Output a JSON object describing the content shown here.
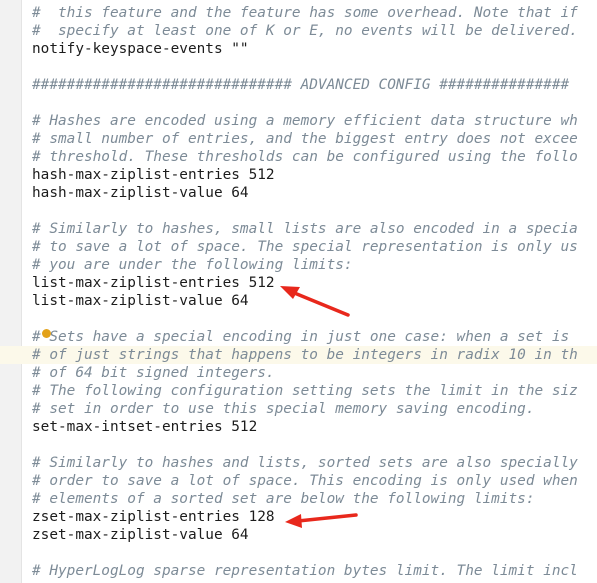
{
  "editor": {
    "lines": [
      {
        "text": "#  this feature and the feature has some overhead. Note that if",
        "kind": "comment"
      },
      {
        "text": "#  specify at least one of K or E, no events will be delivered.",
        "kind": "comment"
      },
      {
        "text": "notify-keyspace-events \"\"",
        "kind": "code"
      },
      {
        "text": "",
        "kind": "blank"
      },
      {
        "text": "############################## ADVANCED CONFIG ###############",
        "kind": "comment"
      },
      {
        "text": "",
        "kind": "blank"
      },
      {
        "text": "# Hashes are encoded using a memory efficient data structure wh",
        "kind": "comment"
      },
      {
        "text": "# small number of entries, and the biggest entry does not excee",
        "kind": "comment"
      },
      {
        "text": "# threshold. These thresholds can be configured using the follo",
        "kind": "comment"
      },
      {
        "text": "hash-max-ziplist-entries 512",
        "kind": "code"
      },
      {
        "text": "hash-max-ziplist-value 64",
        "kind": "code"
      },
      {
        "text": "",
        "kind": "blank"
      },
      {
        "text": "# Similarly to hashes, small lists are also encoded in a specia",
        "kind": "comment"
      },
      {
        "text": "# to save a lot of space. The special representation is only us",
        "kind": "comment"
      },
      {
        "text": "# you are under the following limits:",
        "kind": "comment"
      },
      {
        "text": "list-max-ziplist-entries 512",
        "kind": "code"
      },
      {
        "text": "list-max-ziplist-value 64",
        "kind": "code"
      },
      {
        "text": "",
        "kind": "blank"
      },
      {
        "text": "# Sets have a special encoding in just one case: when a set is",
        "kind": "comment"
      },
      {
        "text": "# of just strings that happens to be integers in radix 10 in th",
        "kind": "comment",
        "highlight": true
      },
      {
        "text": "# of 64 bit signed integers.",
        "kind": "comment"
      },
      {
        "text": "# The following configuration setting sets the limit in the siz",
        "kind": "comment"
      },
      {
        "text": "# set in order to use this special memory saving encoding.",
        "kind": "comment"
      },
      {
        "text": "set-max-intset-entries 512",
        "kind": "code"
      },
      {
        "text": "",
        "kind": "blank"
      },
      {
        "text": "# Similarly to hashes and lists, sorted sets are also specially",
        "kind": "comment"
      },
      {
        "text": "# order to save a lot of space. This encoding is only used when",
        "kind": "comment"
      },
      {
        "text": "# elements of a sorted set are below the following limits:",
        "kind": "comment"
      },
      {
        "text": "zset-max-ziplist-entries 128",
        "kind": "code"
      },
      {
        "text": "zset-max-ziplist-value 64",
        "kind": "code"
      },
      {
        "text": "",
        "kind": "blank"
      },
      {
        "text": "# HyperLogLog sparse representation bytes limit. The limit incl",
        "kind": "comment"
      }
    ]
  },
  "annotations": {
    "arrow_color": "#e8281c"
  }
}
